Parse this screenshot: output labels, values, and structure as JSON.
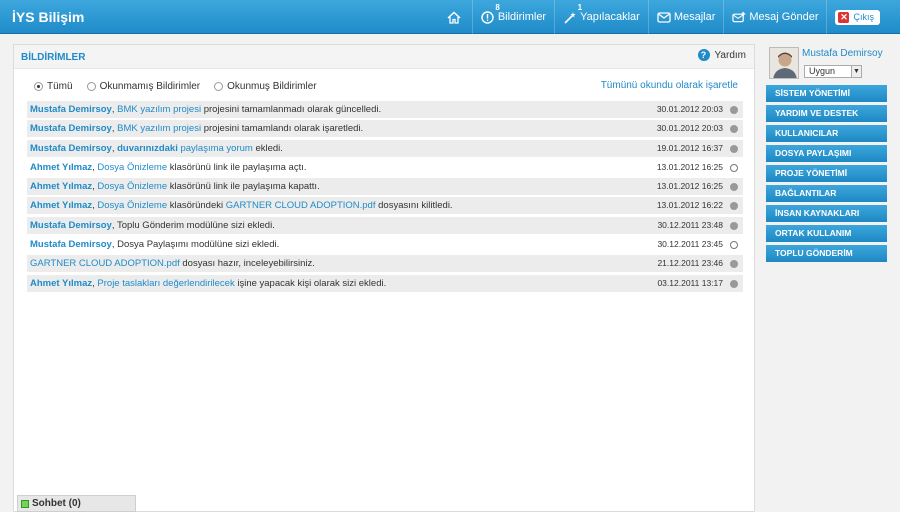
{
  "brand": "İYS Bilişim",
  "topnav": {
    "home_icon": "home-icon",
    "notifications": {
      "label": "Bildirimler",
      "count": "8"
    },
    "todos": {
      "label": "Yapılacaklar",
      "count": "1"
    },
    "messages": {
      "label": "Mesajlar"
    },
    "send_message": {
      "label": "Mesaj Gönder"
    },
    "logout": {
      "label": "Çıkış"
    }
  },
  "main": {
    "title": "BİLDİRİMLER",
    "help": "Yardım",
    "filters": [
      {
        "label": "Tümü",
        "selected": true
      },
      {
        "label": "Okunmamış Bildirimler",
        "selected": false
      },
      {
        "label": "Okunmuş Bildirimler",
        "selected": false
      }
    ],
    "mark_all_read": "Tümünü okundu olarak işaretle",
    "notifications": [
      {
        "parts": [
          {
            "k": "u",
            "v": "Mustafa Demirsoy"
          },
          {
            "k": "t",
            "v": ", "
          },
          {
            "k": "l",
            "v": "BMK yazılım projesi"
          },
          {
            "k": "t",
            "v": " projesini tamamlanmadı olarak güncelledi."
          }
        ],
        "date": "30.01.2012 20:03",
        "read": false
      },
      {
        "parts": [
          {
            "k": "u",
            "v": "Mustafa Demirsoy"
          },
          {
            "k": "t",
            "v": ", "
          },
          {
            "k": "l",
            "v": "BMK yazılım projesi"
          },
          {
            "k": "t",
            "v": " projesini tamamlandı olarak işaretledi."
          }
        ],
        "date": "30.01.2012 20:03",
        "read": false
      },
      {
        "parts": [
          {
            "k": "u",
            "v": "Mustafa Demirsoy"
          },
          {
            "k": "t",
            "v": ", "
          },
          {
            "k": "u",
            "v": "duvarınızdaki"
          },
          {
            "k": "t",
            "v": " "
          },
          {
            "k": "l",
            "v": "paylaşıma yorum"
          },
          {
            "k": "t",
            "v": " ekledi."
          }
        ],
        "date": "19.01.2012 16:37",
        "read": false
      },
      {
        "parts": [
          {
            "k": "u",
            "v": "Ahmet Yılmaz"
          },
          {
            "k": "t",
            "v": ", "
          },
          {
            "k": "l",
            "v": "Dosya Önizleme"
          },
          {
            "k": "t",
            "v": " klasörünü link ile paylaşıma açtı."
          }
        ],
        "date": "13.01.2012 16:25",
        "read": true
      },
      {
        "parts": [
          {
            "k": "u",
            "v": "Ahmet Yılmaz"
          },
          {
            "k": "t",
            "v": ", "
          },
          {
            "k": "l",
            "v": "Dosya Önizleme"
          },
          {
            "k": "t",
            "v": " klasörünü link ile paylaşıma kapattı."
          }
        ],
        "date": "13.01.2012 16:25",
        "read": false
      },
      {
        "parts": [
          {
            "k": "u",
            "v": "Ahmet Yılmaz"
          },
          {
            "k": "t",
            "v": ", "
          },
          {
            "k": "l",
            "v": "Dosya Önizleme"
          },
          {
            "k": "t",
            "v": " klasöründeki "
          },
          {
            "k": "l",
            "v": "GARTNER CLOUD ADOPTION.pdf"
          },
          {
            "k": "t",
            "v": " dosyasını kilitledi."
          }
        ],
        "date": "13.01.2012 16:22",
        "read": false
      },
      {
        "parts": [
          {
            "k": "u",
            "v": "Mustafa Demirsoy"
          },
          {
            "k": "t",
            "v": ", Toplu Gönderim modülüne sizi ekledi."
          }
        ],
        "date": "30.12.2011 23:48",
        "read": false
      },
      {
        "parts": [
          {
            "k": "u",
            "v": "Mustafa Demirsoy"
          },
          {
            "k": "t",
            "v": ", Dosya Paylaşımı modülüne sizi ekledi."
          }
        ],
        "date": "30.12.2011 23:45",
        "read": true
      },
      {
        "parts": [
          {
            "k": "l",
            "v": "GARTNER CLOUD ADOPTION.pdf"
          },
          {
            "k": "t",
            "v": " dosyası hazır, inceleyebilirsiniz."
          }
        ],
        "date": "21.12.2011 23:46",
        "read": false
      },
      {
        "parts": [
          {
            "k": "u",
            "v": "Ahmet Yılmaz"
          },
          {
            "k": "t",
            "v": ", "
          },
          {
            "k": "l",
            "v": "Proje taslakları değerlendirilecek"
          },
          {
            "k": "t",
            "v": " işine yapacak kişi olarak sizi ekledi."
          }
        ],
        "date": "03.12.2011 13:17",
        "read": false
      }
    ]
  },
  "chat": {
    "label": "Sohbet (0)"
  },
  "sidebar": {
    "user_name": "Mustafa Demirsoy",
    "status": "Uygun",
    "menu": [
      "SİSTEM YÖNETİMİ",
      "YARDIM VE DESTEK",
      "KULLANICILAR",
      "DOSYA PAYLAŞIMI",
      "PROJE YÖNETİMİ",
      "BAĞLANTILAR",
      "İNSAN KAYNAKLARI",
      "ORTAK KULLANIM",
      "TOPLU GÖNDERİM"
    ]
  },
  "colors": {
    "accent": "#1f8bc8",
    "topbar": "#2a97d2",
    "row_unread": "#ececec"
  }
}
